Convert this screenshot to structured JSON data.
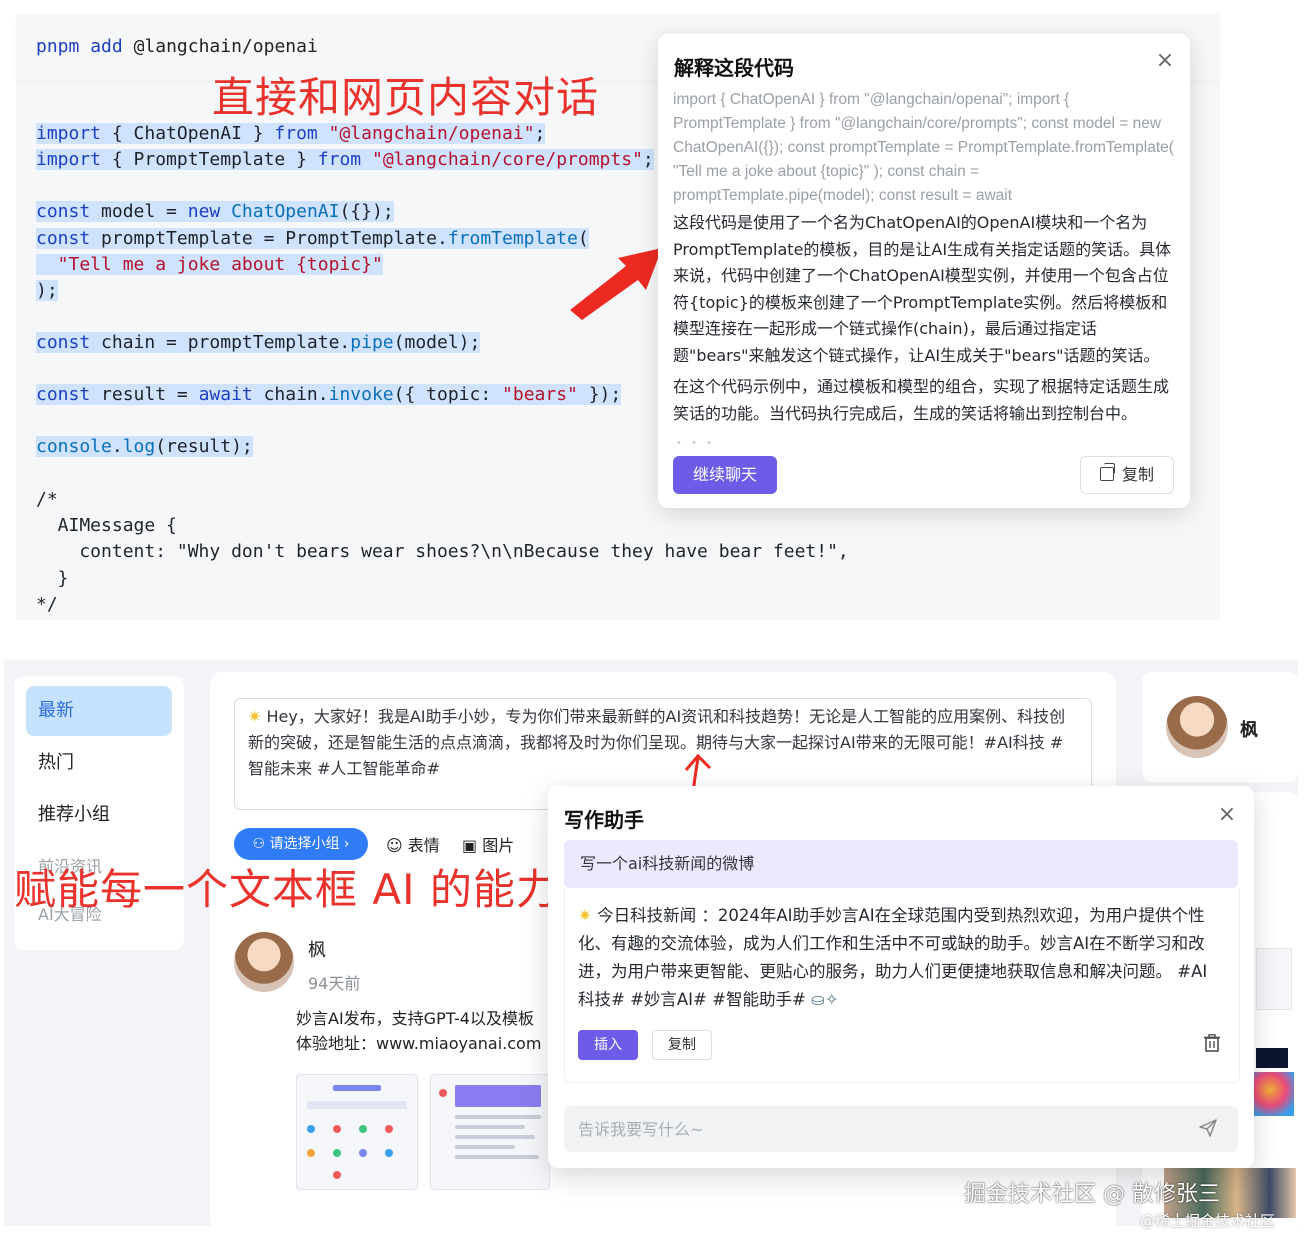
{
  "top": {
    "install_cmd": {
      "pm": "pnpm",
      "verb": "add",
      "pkg": "@langchain/openai"
    },
    "title_overlay": "直接和网页内容对话",
    "code": {
      "l1_kw": "import",
      "l1_a": " { ChatOpenAI } ",
      "l1_from": "from",
      "l1_sp": " ",
      "l1_str": "\"@langchain/openai\"",
      "l1_end": ";",
      "l2_kw": "import",
      "l2_a": " { PromptTemplate } ",
      "l2_from": "from",
      "l2_sp": " ",
      "l2_str": "\"@langchain/core/prompts\"",
      "l2_end": ";",
      "l3_kw": "const",
      "l3_a": " model = ",
      "l3_new": "new",
      "l3_sp": " ",
      "l3_fn": "ChatOpenAI",
      "l3_end": "({});",
      "l4_kw": "const",
      "l4_a": " promptTemplate = PromptTemplate.",
      "l4_fn": "fromTemplate",
      "l4_end": "(",
      "l5_str": "  \"Tell me a joke about {topic}\"",
      "l6": ");",
      "l7_kw": "const",
      "l7_a": " chain = promptTemplate.",
      "l7_fn": "pipe",
      "l7_end": "(model);",
      "l8_kw": "const",
      "l8_a": " result = ",
      "l8_aw": "await",
      "l8_b": " chain.",
      "l8_fn": "invoke",
      "l8_c": "({ topic: ",
      "l8_str": "\"bears\"",
      "l8_end": " });",
      "l9_fn": "console",
      "l9_a": ".",
      "l9_fn2": "log",
      "l9_end": "(result);",
      "c1": "/*",
      "c2": "  AIMessage {",
      "c3": "    content: \"Why don't bears wear shoes?\\n\\nBecause they have bear feet!\",",
      "c4": "  }",
      "c5": "*/"
    },
    "explain_dialog": {
      "title": "解释这段代码",
      "source_text": "import { ChatOpenAI } from \"@langchain/openai\"; import { PromptTemplate } from \"@langchain/core/prompts\"; const model = new ChatOpenAI({}); const promptTemplate = PromptTemplate.fromTemplate( \"Tell me a joke about {topic}\" ); const chain = promptTemplate.pipe(model); const result = await",
      "p1": "这段代码是使用了一个名为ChatOpenAI的OpenAI模块和一个名为PromptTemplate的模板，目的是让AI生成有关指定话题的笑话。具体来说，代码中创建了一个ChatOpenAI模型实例，并使用一个包含占位符{topic}的模板来创建了一个PromptTemplate实例。然后将模板和模型连接在一起形成一个链式操作(chain)，最后通过指定话题\"bears\"来触发这个链式操作，让AI生成关于\"bears\"话题的笑话。",
      "p2": "在这个代码示例中，通过模板和模型的组合，实现了根据特定话题生成笑话的功能。当代码执行完成后，生成的笑话将输出到控制台中。",
      "continue_label": "继续聊天",
      "copy_label": "复制"
    }
  },
  "bottom": {
    "sidebar": [
      "最新",
      "热门",
      "推荐小组",
      "前沿资讯",
      "AI大冒险"
    ],
    "composer_text": "Hey，大家好！我是AI助手小妙，专为你们带来最新鲜的AI资讯和科技趋势！无论是人工智能的应用案例、科技创新的突破，还是智能生活的点点滴滴，我都将及时为你们呈现。期待与大家一起探讨AI带来的无限可能！#AI科技 #智能未来 #人工智能革命#",
    "group_label": "请选择小组 ›",
    "emoji_label": "表情",
    "image_label": "图片",
    "banner": "赋能每一个文本框 AI 的能力",
    "post": {
      "author": "枫",
      "time": "94天前",
      "line1": "妙言AI发布，支持GPT-4以及模板",
      "line2": "体验地址：www.miaoyanai.com"
    },
    "profile_name": "枫",
    "writer": {
      "title": "写作助手",
      "prompt": "写一个ai科技新闻的微博",
      "result": "今日科技新闻 ：2024年AI助手妙言AI在全球范围内受到热烈欢迎，为用户提供个性化、有趣的交流体验，成为人们工作和生活中不可或缺的助手。妙言AI在不断学习和改进，为用户带来更智能、更贴心的服务，助力人们更便捷地获取信息和解决问题。 #AI科技# #妙言AI# #智能助手#",
      "insert_label": "插入",
      "copy_label": "复制",
      "input_placeholder": "告诉我要写什么~"
    },
    "watermark": "掘金技术社区 @ 散修张三",
    "watermark2": "@稀土掘金技术社区"
  },
  "colors": {
    "accent": "#6c5ce7",
    "annotation_red": "#e8322b",
    "link_blue": "#2f7cf6"
  }
}
